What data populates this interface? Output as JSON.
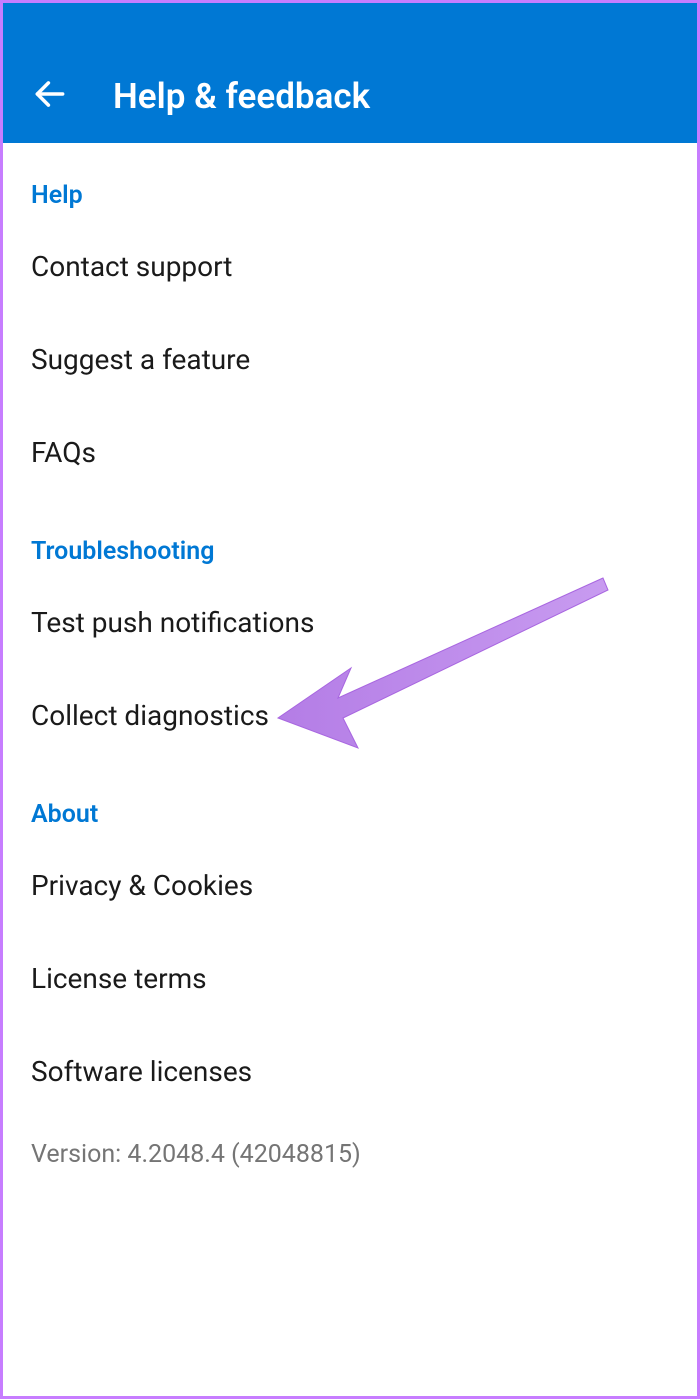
{
  "header": {
    "title": "Help & feedback"
  },
  "sections": {
    "help": {
      "label": "Help",
      "items": {
        "contact_support": "Contact support",
        "suggest_feature": "Suggest a feature",
        "faqs": "FAQs"
      }
    },
    "troubleshooting": {
      "label": "Troubleshooting",
      "items": {
        "test_push": "Test push notifications",
        "collect_diagnostics": "Collect diagnostics"
      }
    },
    "about": {
      "label": "About",
      "items": {
        "privacy_cookies": "Privacy & Cookies",
        "license_terms": "License terms",
        "software_licenses": "Software licenses"
      }
    }
  },
  "version": "Version: 4.2048.4 (42048815)",
  "colors": {
    "primary": "#0078d4",
    "annotation": "#b47de6"
  }
}
